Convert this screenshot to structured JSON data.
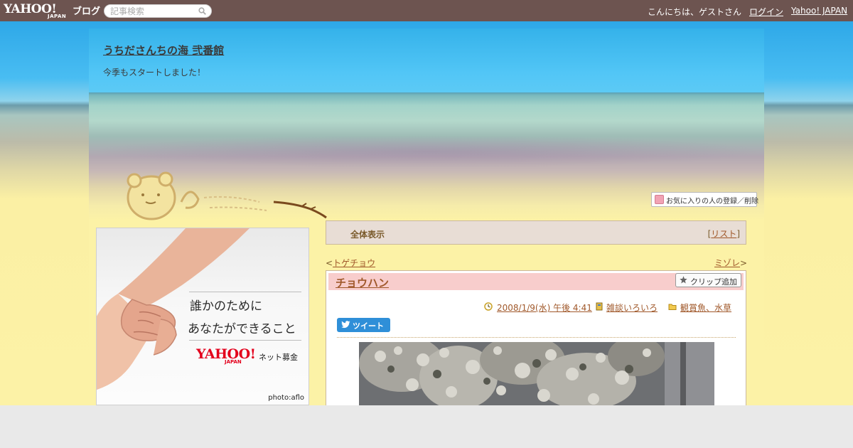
{
  "topbar": {
    "logo_text": "YAHOO!",
    "logo_sub": "JAPAN",
    "logo_blog": "ブログ",
    "search_placeholder": "記事検索",
    "greeting": "こんにちは、ゲストさん",
    "login": "ログイン",
    "yahoo_japan": "Yahoo! JAPAN"
  },
  "blog": {
    "title": "うちださんちの海 弐番館",
    "description": "今季もスタートしました！",
    "favorite_button": "お気に入りの人の登録／削除"
  },
  "ad": {
    "line1": "誰かのために",
    "line2": "あなたができること",
    "brand": "YAHOO!",
    "brand_sub": "JAPAN",
    "service": "ネット募金",
    "credit": "photo:aflo"
  },
  "main": {
    "view_all": "全体表示",
    "list_open": "[",
    "list_label": "リスト",
    "list_close": "]",
    "prev_marker": "<",
    "prev_label": "トゲチョウ",
    "next_label": "ミゾレ",
    "next_marker": ">"
  },
  "post": {
    "title": "チョウハン",
    "clip_button": "クリップ追加",
    "datetime": "2008/1/9(水) 午後 4:41",
    "theme": "雑談いろいろ",
    "category": "観賞魚、水草",
    "tweet_button": "ツイート"
  },
  "colors": {
    "topbar": "#6d5450",
    "link": "#a0582a",
    "post_header": "#f8cdcc",
    "tweet": "#2f8fd8",
    "sand": "#fcf2a6"
  }
}
